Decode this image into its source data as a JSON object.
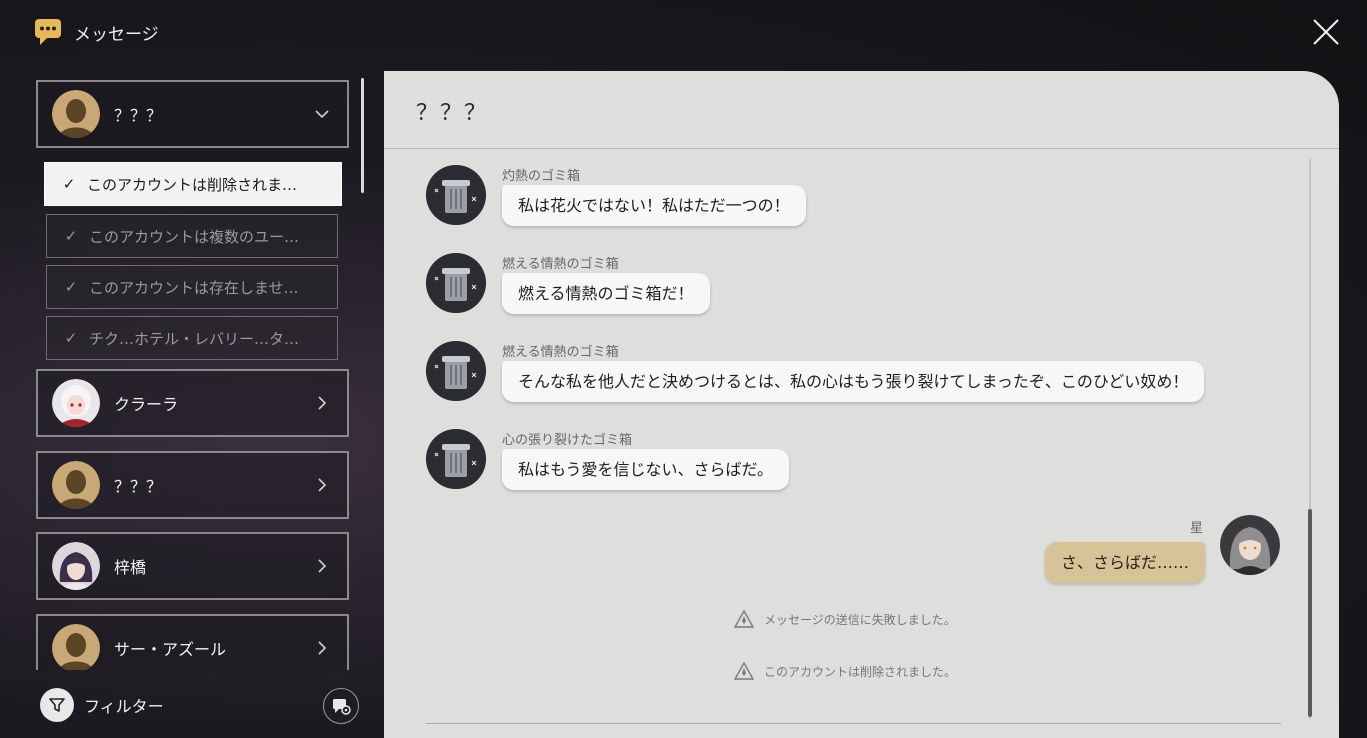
{
  "header": {
    "title": "メッセージ"
  },
  "contacts": [
    {
      "name": "？？？",
      "avatar": "silhouette"
    },
    {
      "name": "クラーラ",
      "avatar": "clara"
    },
    {
      "name": "？？？",
      "avatar": "silhouette"
    },
    {
      "name": "梓橋",
      "avatar": "zixiao"
    },
    {
      "name": "サー・アズール",
      "avatar": "silhouette"
    }
  ],
  "threads": [
    {
      "label": "このアカウントは削除されま…",
      "active": true
    },
    {
      "label": "このアカウントは複数のユー…",
      "active": false
    },
    {
      "label": "このアカウントは存在しませ…",
      "active": false
    },
    {
      "label": "チク…ホテル・レバリー…タ…",
      "active": false
    }
  ],
  "filter": {
    "label": "フィルター"
  },
  "chat": {
    "title": "？？？",
    "messages": [
      {
        "sender": "灼熱のゴミ箱",
        "text": "私は花火ではない！私はただ一つの！"
      },
      {
        "sender": "燃える情熱のゴミ箱",
        "text": "燃える情熱のゴミ箱だ！"
      },
      {
        "sender": "燃える情熱のゴミ箱",
        "text": "そんな私を他人だと決めつけるとは、私の心はもう張り裂けてしまったぞ、このひどい奴め！"
      },
      {
        "sender": "心の張り裂けたゴミ箱",
        "text": "私はもう愛を信じない、さらばだ。"
      }
    ],
    "self_message": {
      "sender": "星",
      "text": "さ、さらばだ……"
    },
    "notices": [
      "メッセージの送信に失敗しました。",
      "このアカウントは削除されました。"
    ]
  },
  "colors": {
    "self_bubble": "#d6c397",
    "other_bubble": "#f7f7f7",
    "chat_bg": "#dededd"
  }
}
